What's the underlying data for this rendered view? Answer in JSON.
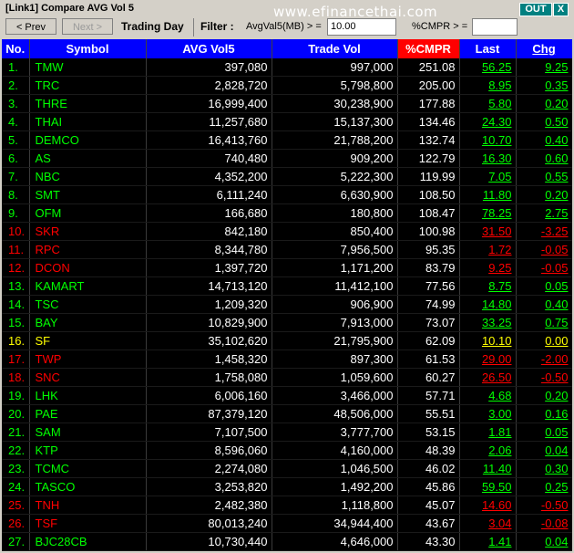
{
  "window": {
    "title": "[Link1] Compare AVG Vol 5",
    "out_label": "OUT",
    "close_label": "X"
  },
  "toolbar": {
    "prev_label": "< Prev",
    "next_label": "Next >",
    "trading_day": "Trading Day",
    "filter_label": "Filter :",
    "avg_field_label": "AvgVal5(MB) > =",
    "avg_field_value": "10.00",
    "cmpr_field_label": "%CMPR > =",
    "cmpr_field_value": "",
    "watermark": "www.efinancethai.com"
  },
  "headers": {
    "no": "No.",
    "symbol": "Symbol",
    "avg": "AVG Vol5",
    "trade": "Trade Vol",
    "cmpr": "%CMPR",
    "last": "Last",
    "chg": "Chg"
  },
  "colors": {
    "up": "#00ff00",
    "down": "#ff0000",
    "unchanged": "#ffff00",
    "header": "#0000ff"
  },
  "rows": [
    {
      "no": "1.",
      "symbol": "TMW",
      "avg": "397,080",
      "trade": "997,000",
      "cmpr": "251.08",
      "last": "56.25",
      "chg": "9.25",
      "dir": "g"
    },
    {
      "no": "2.",
      "symbol": "TRC",
      "avg": "2,828,720",
      "trade": "5,798,800",
      "cmpr": "205.00",
      "last": "8.95",
      "chg": "0.35",
      "dir": "g"
    },
    {
      "no": "3.",
      "symbol": "THRE",
      "avg": "16,999,400",
      "trade": "30,238,900",
      "cmpr": "177.88",
      "last": "5.80",
      "chg": "0.20",
      "dir": "g"
    },
    {
      "no": "4.",
      "symbol": "THAI",
      "avg": "11,257,680",
      "trade": "15,137,300",
      "cmpr": "134.46",
      "last": "24.30",
      "chg": "0.50",
      "dir": "g"
    },
    {
      "no": "5.",
      "symbol": "DEMCO",
      "avg": "16,413,760",
      "trade": "21,788,200",
      "cmpr": "132.74",
      "last": "10.70",
      "chg": "0.40",
      "dir": "g"
    },
    {
      "no": "6.",
      "symbol": "AS",
      "avg": "740,480",
      "trade": "909,200",
      "cmpr": "122.79",
      "last": "16.30",
      "chg": "0.60",
      "dir": "g"
    },
    {
      "no": "7.",
      "symbol": "NBC",
      "avg": "4,352,200",
      "trade": "5,222,300",
      "cmpr": "119.99",
      "last": "7.05",
      "chg": "0.55",
      "dir": "g"
    },
    {
      "no": "8.",
      "symbol": "SMT",
      "avg": "6,111,240",
      "trade": "6,630,900",
      "cmpr": "108.50",
      "last": "11.80",
      "chg": "0.20",
      "dir": "g"
    },
    {
      "no": "9.",
      "symbol": "OFM",
      "avg": "166,680",
      "trade": "180,800",
      "cmpr": "108.47",
      "last": "78.25",
      "chg": "2.75",
      "dir": "g"
    },
    {
      "no": "10.",
      "symbol": "SKR",
      "avg": "842,180",
      "trade": "850,400",
      "cmpr": "100.98",
      "last": "31.50",
      "chg": "-3.25",
      "dir": "r"
    },
    {
      "no": "11.",
      "symbol": "RPC",
      "avg": "8,344,780",
      "trade": "7,956,500",
      "cmpr": "95.35",
      "last": "1.72",
      "chg": "-0.05",
      "dir": "r"
    },
    {
      "no": "12.",
      "symbol": "DCON",
      "avg": "1,397,720",
      "trade": "1,171,200",
      "cmpr": "83.79",
      "last": "9.25",
      "chg": "-0.05",
      "dir": "r"
    },
    {
      "no": "13.",
      "symbol": "KAMART",
      "avg": "14,713,120",
      "trade": "11,412,100",
      "cmpr": "77.56",
      "last": "8.75",
      "chg": "0.05",
      "dir": "g"
    },
    {
      "no": "14.",
      "symbol": "TSC",
      "avg": "1,209,320",
      "trade": "906,900",
      "cmpr": "74.99",
      "last": "14.80",
      "chg": "0.40",
      "dir": "g"
    },
    {
      "no": "15.",
      "symbol": "BAY",
      "avg": "10,829,900",
      "trade": "7,913,000",
      "cmpr": "73.07",
      "last": "33.25",
      "chg": "0.75",
      "dir": "g"
    },
    {
      "no": "16.",
      "symbol": "SF",
      "avg": "35,102,620",
      "trade": "21,795,900",
      "cmpr": "62.09",
      "last": "10.10",
      "chg": "0.00",
      "dir": "y"
    },
    {
      "no": "17.",
      "symbol": "TWP",
      "avg": "1,458,320",
      "trade": "897,300",
      "cmpr": "61.53",
      "last": "29.00",
      "chg": "-2.00",
      "dir": "r"
    },
    {
      "no": "18.",
      "symbol": "SNC",
      "avg": "1,758,080",
      "trade": "1,059,600",
      "cmpr": "60.27",
      "last": "26.50",
      "chg": "-0.50",
      "dir": "r"
    },
    {
      "no": "19.",
      "symbol": "LHK",
      "avg": "6,006,160",
      "trade": "3,466,000",
      "cmpr": "57.71",
      "last": "4.68",
      "chg": "0.20",
      "dir": "g"
    },
    {
      "no": "20.",
      "symbol": "PAE",
      "avg": "87,379,120",
      "trade": "48,506,000",
      "cmpr": "55.51",
      "last": "3.00",
      "chg": "0.16",
      "dir": "g"
    },
    {
      "no": "21.",
      "symbol": "SAM",
      "avg": "7,107,500",
      "trade": "3,777,700",
      "cmpr": "53.15",
      "last": "1.81",
      "chg": "0.05",
      "dir": "g"
    },
    {
      "no": "22.",
      "symbol": "KTP",
      "avg": "8,596,060",
      "trade": "4,160,000",
      "cmpr": "48.39",
      "last": "2.06",
      "chg": "0.04",
      "dir": "g"
    },
    {
      "no": "23.",
      "symbol": "TCMC",
      "avg": "2,274,080",
      "trade": "1,046,500",
      "cmpr": "46.02",
      "last": "11.40",
      "chg": "0.30",
      "dir": "g"
    },
    {
      "no": "24.",
      "symbol": "TASCO",
      "avg": "3,253,820",
      "trade": "1,492,200",
      "cmpr": "45.86",
      "last": "59.50",
      "chg": "0.25",
      "dir": "g"
    },
    {
      "no": "25.",
      "symbol": "TNH",
      "avg": "2,482,380",
      "trade": "1,118,800",
      "cmpr": "45.07",
      "last": "14.60",
      "chg": "-0.50",
      "dir": "r"
    },
    {
      "no": "26.",
      "symbol": "TSF",
      "avg": "80,013,240",
      "trade": "34,944,400",
      "cmpr": "43.67",
      "last": "3.04",
      "chg": "-0.08",
      "dir": "r"
    },
    {
      "no": "27.",
      "symbol": "BJC28CB",
      "avg": "10,730,440",
      "trade": "4,646,000",
      "cmpr": "43.30",
      "last": "1.41",
      "chg": "0.04",
      "dir": "g"
    }
  ]
}
